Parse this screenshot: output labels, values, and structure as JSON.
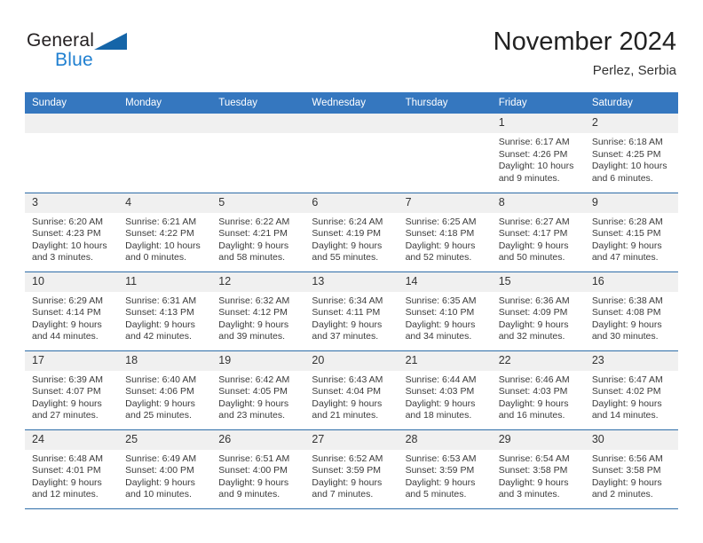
{
  "logo": {
    "word1": "General",
    "word2": "Blue",
    "triangle_color": "#1565a8",
    "blue_color": "#1f7fd0"
  },
  "header": {
    "title": "November 2024",
    "subtitle": "Perlez, Serbia"
  },
  "theme": {
    "header_bg": "#3577bf",
    "row_divider": "#2e6da8",
    "daynum_bg": "#f0f0f0"
  },
  "weekdays": [
    "Sunday",
    "Monday",
    "Tuesday",
    "Wednesday",
    "Thursday",
    "Friday",
    "Saturday"
  ],
  "weeks": [
    [
      {
        "day": "",
        "empty": true
      },
      {
        "day": "",
        "empty": true
      },
      {
        "day": "",
        "empty": true
      },
      {
        "day": "",
        "empty": true
      },
      {
        "day": "",
        "empty": true
      },
      {
        "day": "1",
        "sunrise": "Sunrise: 6:17 AM",
        "sunset": "Sunset: 4:26 PM",
        "daylight1": "Daylight: 10 hours",
        "daylight2": "and 9 minutes."
      },
      {
        "day": "2",
        "sunrise": "Sunrise: 6:18 AM",
        "sunset": "Sunset: 4:25 PM",
        "daylight1": "Daylight: 10 hours",
        "daylight2": "and 6 minutes."
      }
    ],
    [
      {
        "day": "3",
        "sunrise": "Sunrise: 6:20 AM",
        "sunset": "Sunset: 4:23 PM",
        "daylight1": "Daylight: 10 hours",
        "daylight2": "and 3 minutes."
      },
      {
        "day": "4",
        "sunrise": "Sunrise: 6:21 AM",
        "sunset": "Sunset: 4:22 PM",
        "daylight1": "Daylight: 10 hours",
        "daylight2": "and 0 minutes."
      },
      {
        "day": "5",
        "sunrise": "Sunrise: 6:22 AM",
        "sunset": "Sunset: 4:21 PM",
        "daylight1": "Daylight: 9 hours",
        "daylight2": "and 58 minutes."
      },
      {
        "day": "6",
        "sunrise": "Sunrise: 6:24 AM",
        "sunset": "Sunset: 4:19 PM",
        "daylight1": "Daylight: 9 hours",
        "daylight2": "and 55 minutes."
      },
      {
        "day": "7",
        "sunrise": "Sunrise: 6:25 AM",
        "sunset": "Sunset: 4:18 PM",
        "daylight1": "Daylight: 9 hours",
        "daylight2": "and 52 minutes."
      },
      {
        "day": "8",
        "sunrise": "Sunrise: 6:27 AM",
        "sunset": "Sunset: 4:17 PM",
        "daylight1": "Daylight: 9 hours",
        "daylight2": "and 50 minutes."
      },
      {
        "day": "9",
        "sunrise": "Sunrise: 6:28 AM",
        "sunset": "Sunset: 4:15 PM",
        "daylight1": "Daylight: 9 hours",
        "daylight2": "and 47 minutes."
      }
    ],
    [
      {
        "day": "10",
        "sunrise": "Sunrise: 6:29 AM",
        "sunset": "Sunset: 4:14 PM",
        "daylight1": "Daylight: 9 hours",
        "daylight2": "and 44 minutes."
      },
      {
        "day": "11",
        "sunrise": "Sunrise: 6:31 AM",
        "sunset": "Sunset: 4:13 PM",
        "daylight1": "Daylight: 9 hours",
        "daylight2": "and 42 minutes."
      },
      {
        "day": "12",
        "sunrise": "Sunrise: 6:32 AM",
        "sunset": "Sunset: 4:12 PM",
        "daylight1": "Daylight: 9 hours",
        "daylight2": "and 39 minutes."
      },
      {
        "day": "13",
        "sunrise": "Sunrise: 6:34 AM",
        "sunset": "Sunset: 4:11 PM",
        "daylight1": "Daylight: 9 hours",
        "daylight2": "and 37 minutes."
      },
      {
        "day": "14",
        "sunrise": "Sunrise: 6:35 AM",
        "sunset": "Sunset: 4:10 PM",
        "daylight1": "Daylight: 9 hours",
        "daylight2": "and 34 minutes."
      },
      {
        "day": "15",
        "sunrise": "Sunrise: 6:36 AM",
        "sunset": "Sunset: 4:09 PM",
        "daylight1": "Daylight: 9 hours",
        "daylight2": "and 32 minutes."
      },
      {
        "day": "16",
        "sunrise": "Sunrise: 6:38 AM",
        "sunset": "Sunset: 4:08 PM",
        "daylight1": "Daylight: 9 hours",
        "daylight2": "and 30 minutes."
      }
    ],
    [
      {
        "day": "17",
        "sunrise": "Sunrise: 6:39 AM",
        "sunset": "Sunset: 4:07 PM",
        "daylight1": "Daylight: 9 hours",
        "daylight2": "and 27 minutes."
      },
      {
        "day": "18",
        "sunrise": "Sunrise: 6:40 AM",
        "sunset": "Sunset: 4:06 PM",
        "daylight1": "Daylight: 9 hours",
        "daylight2": "and 25 minutes."
      },
      {
        "day": "19",
        "sunrise": "Sunrise: 6:42 AM",
        "sunset": "Sunset: 4:05 PM",
        "daylight1": "Daylight: 9 hours",
        "daylight2": "and 23 minutes."
      },
      {
        "day": "20",
        "sunrise": "Sunrise: 6:43 AM",
        "sunset": "Sunset: 4:04 PM",
        "daylight1": "Daylight: 9 hours",
        "daylight2": "and 21 minutes."
      },
      {
        "day": "21",
        "sunrise": "Sunrise: 6:44 AM",
        "sunset": "Sunset: 4:03 PM",
        "daylight1": "Daylight: 9 hours",
        "daylight2": "and 18 minutes."
      },
      {
        "day": "22",
        "sunrise": "Sunrise: 6:46 AM",
        "sunset": "Sunset: 4:03 PM",
        "daylight1": "Daylight: 9 hours",
        "daylight2": "and 16 minutes."
      },
      {
        "day": "23",
        "sunrise": "Sunrise: 6:47 AM",
        "sunset": "Sunset: 4:02 PM",
        "daylight1": "Daylight: 9 hours",
        "daylight2": "and 14 minutes."
      }
    ],
    [
      {
        "day": "24",
        "sunrise": "Sunrise: 6:48 AM",
        "sunset": "Sunset: 4:01 PM",
        "daylight1": "Daylight: 9 hours",
        "daylight2": "and 12 minutes."
      },
      {
        "day": "25",
        "sunrise": "Sunrise: 6:49 AM",
        "sunset": "Sunset: 4:00 PM",
        "daylight1": "Daylight: 9 hours",
        "daylight2": "and 10 minutes."
      },
      {
        "day": "26",
        "sunrise": "Sunrise: 6:51 AM",
        "sunset": "Sunset: 4:00 PM",
        "daylight1": "Daylight: 9 hours",
        "daylight2": "and 9 minutes."
      },
      {
        "day": "27",
        "sunrise": "Sunrise: 6:52 AM",
        "sunset": "Sunset: 3:59 PM",
        "daylight1": "Daylight: 9 hours",
        "daylight2": "and 7 minutes."
      },
      {
        "day": "28",
        "sunrise": "Sunrise: 6:53 AM",
        "sunset": "Sunset: 3:59 PM",
        "daylight1": "Daylight: 9 hours",
        "daylight2": "and 5 minutes."
      },
      {
        "day": "29",
        "sunrise": "Sunrise: 6:54 AM",
        "sunset": "Sunset: 3:58 PM",
        "daylight1": "Daylight: 9 hours",
        "daylight2": "and 3 minutes."
      },
      {
        "day": "30",
        "sunrise": "Sunrise: 6:56 AM",
        "sunset": "Sunset: 3:58 PM",
        "daylight1": "Daylight: 9 hours",
        "daylight2": "and 2 minutes."
      }
    ]
  ]
}
